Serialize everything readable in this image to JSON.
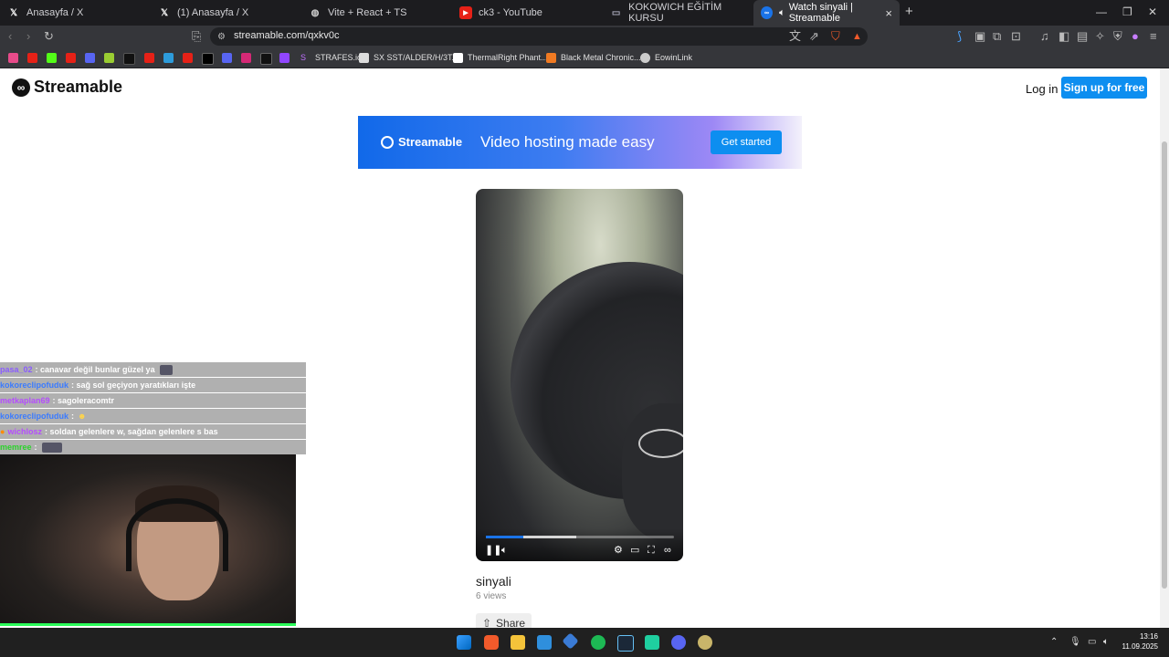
{
  "tabs": [
    {
      "title": "Anasayfa / X",
      "icon": "x-logo-icon"
    },
    {
      "title": "(1) Anasayfa / X",
      "icon": "x-logo-icon"
    },
    {
      "title": "Vite + React + TS",
      "icon": "globe-icon"
    },
    {
      "title": "ck3 - YouTube",
      "icon": "youtube-icon"
    },
    {
      "title": "KOKOWICH EĞİTİM KURSU",
      "icon": "page-icon"
    },
    {
      "title": "Watch sinyali | Streamable",
      "icon": "streamable-icon"
    }
  ],
  "address_bar": {
    "url": "streamable.com/qxkv0c"
  },
  "bookmarks": [
    {
      "label": "STRAFES.io"
    },
    {
      "label": "SX SST/ALDER/H/3T..."
    },
    {
      "label": "ThermalRight Phant..."
    },
    {
      "label": "Black Metal Chronic..."
    },
    {
      "label": "EowinLink"
    }
  ],
  "site": {
    "logo": "Streamable",
    "login": "Log in",
    "signup": "Sign up for free"
  },
  "banner": {
    "logo": "Streamable",
    "tagline": "Video hosting made easy",
    "cta": "Get started"
  },
  "video": {
    "title": "sinyali",
    "views": "6 views",
    "share_label": "Share",
    "played_fraction": 0.2,
    "buffered_fraction": 0.48
  },
  "chat": [
    {
      "user": "pasa_02",
      "message": ": canavar değil bunlar güzel ya",
      "color": "#8a5cff"
    },
    {
      "user": "kokoreclipofuduk",
      "message": ": sağ sol geçiyon yaratıkları işte",
      "color": "#3b7bff"
    },
    {
      "user": "metkaplan69",
      "message": ": sagoleracomtr",
      "color": "#b54cff"
    },
    {
      "user": "kokoreclipofuduk",
      "message": ":",
      "color": "#3b7bff"
    },
    {
      "user": "wichlosz",
      "message": ": soldan gelenlere w, sağdan gelenlere s bas",
      "color": "#b54cff"
    },
    {
      "user": "memree",
      "message": ":",
      "color": "#2bd32b"
    }
  ],
  "taskbar": {
    "time": "13:16",
    "date": "11.09.2025"
  },
  "colors": {
    "accent": "#0d8ef0",
    "tabbar": "#1c1c1f",
    "toolbar": "#35363a",
    "webcam_border": "#2bff5a"
  }
}
